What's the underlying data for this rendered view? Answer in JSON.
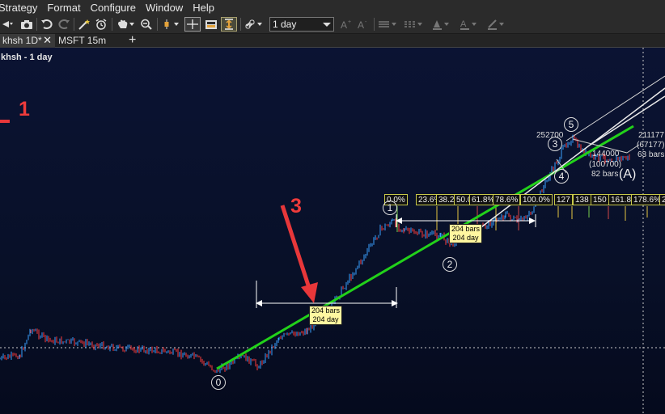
{
  "menu": [
    "Strategy",
    "Format",
    "Configure",
    "Window",
    "Help"
  ],
  "toolbar": {
    "interval": "1 day"
  },
  "tabs": {
    "active": "khsh 1D*",
    "close": "✕",
    "second": "MSFT 15m",
    "add": "+"
  },
  "chart": {
    "title": "khsh - 1 day",
    "annotations": {
      "one": "1",
      "three": "3"
    },
    "fib_labels": [
      "0.0%",
      "23.6%",
      "38.2%",
      "50.0%",
      "61.8%",
      "78.6%",
      "100.0%",
      "127",
      "138",
      "150",
      "161.8",
      "178.6%",
      "2"
    ],
    "bar_count_1": {
      "line1": "204 bars",
      "line2": "204 day"
    },
    "bar_count_2": {
      "line1": "204 bars",
      "line2": "204 day"
    },
    "waves": {
      "w0": "0",
      "w1": "1",
      "w2": "2",
      "w3": "3",
      "w4": "4",
      "w5": "5",
      "wA": "(A)"
    },
    "price_labels": {
      "p1": "252700",
      "p2": "144000",
      "p3": "(100700)",
      "p4": "82 bars",
      "p5": "211177",
      "p6": "(67177)",
      "p7": "63 bars"
    },
    "colors": {
      "up": "#3aa0ff",
      "down": "#ff3b3b",
      "trend": "#22d11a",
      "arrow": "#e8373a"
    }
  }
}
